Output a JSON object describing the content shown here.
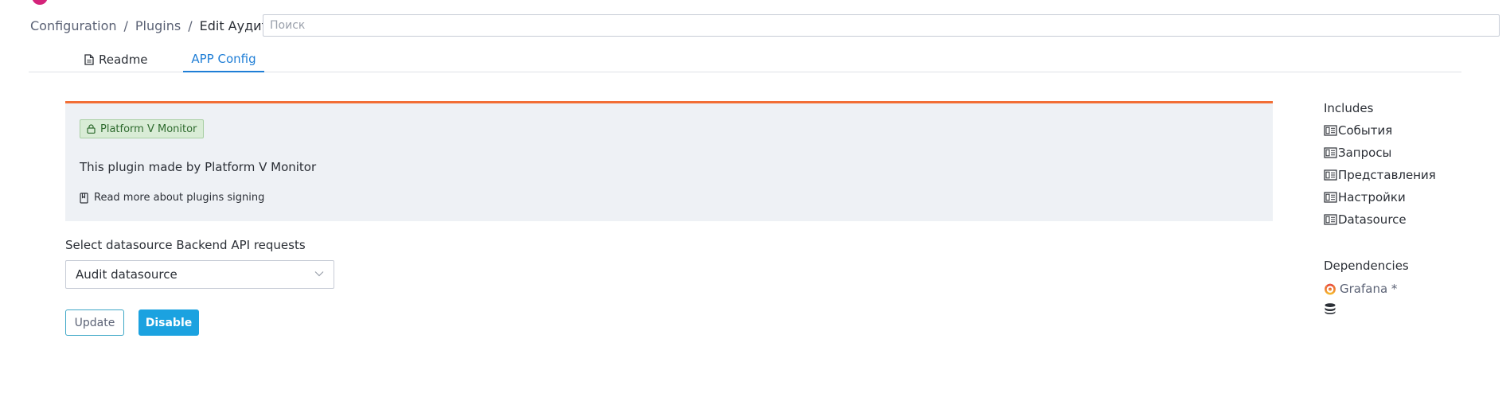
{
  "breadcrumb": {
    "items": [
      "Configuration",
      "Plugins"
    ],
    "separator": "/",
    "current": "Edit Аудит"
  },
  "search": {
    "placeholder": "Поиск",
    "value": ""
  },
  "tabs": [
    {
      "label": "Readme",
      "icon": "file-document-icon",
      "active": false
    },
    {
      "label": "APP Config",
      "icon": "",
      "active": true
    }
  ],
  "signature": {
    "badge": "Platform V Monitor",
    "badge_icon": "lock-icon",
    "text": "This plugin made by Platform V Monitor",
    "link": "Read more about plugins signing",
    "link_icon": "book-icon"
  },
  "datasource": {
    "label": "Select datasource Backend API requests",
    "selected": "Audit datasource"
  },
  "buttons": {
    "update": "Update",
    "disable": "Disable"
  },
  "sidebar": {
    "includes_title": "Includes",
    "includes": [
      {
        "label": "События",
        "icon": "dashboard-icon"
      },
      {
        "label": "Запросы",
        "icon": "dashboard-icon"
      },
      {
        "label": "Представления",
        "icon": "dashboard-icon"
      },
      {
        "label": "Настройки",
        "icon": "dashboard-icon"
      },
      {
        "label": "Datasource",
        "icon": "dashboard-icon"
      }
    ],
    "dependencies_title": "Dependencies",
    "dependencies": [
      {
        "label": "Grafana *",
        "icon": "grafana-icon"
      },
      {
        "label": "",
        "icon": "database-icon"
      }
    ]
  },
  "colors": {
    "accent": "#1f7ed6",
    "primary_button": "#1ba2e0",
    "signature_border": "#f26e35",
    "signature_bg": "#eef1f5",
    "badge_bg": "#d9ecd6",
    "badge_text": "#2f6b2f"
  }
}
